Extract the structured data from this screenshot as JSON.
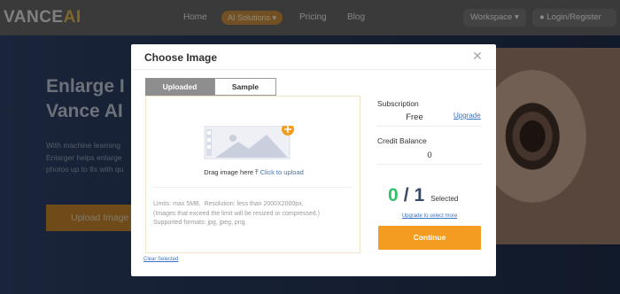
{
  "nav": {
    "logo_main": "VANCE",
    "logo_accent": "AI",
    "home": "Home",
    "ai_solutions": "AI Solutions",
    "pricing": "Pricing",
    "blog": "Blog",
    "workspace": "Workspace",
    "login": "Login/Register"
  },
  "hero": {
    "title": "Enlarge I\nVance AI",
    "description": "With machine learning\nEnlarger helps enlarge\nphotos up to 8x with qu",
    "upload_button": "Upload Image"
  },
  "modal": {
    "title": "Choose Image",
    "close_icon": "close-icon",
    "tabs": [
      {
        "label": "Uploaded",
        "active": true
      },
      {
        "label": "Sample",
        "active": false
      }
    ],
    "drop_zone": {
      "prompt": "Drag image here",
      "upload_icon": "upload-icon",
      "upload_link": "Click to upload",
      "limits": "Limits: max 5MB,  Resolution: less than 2000X2000px,\n(Images that exceed the limit will be resized or compressed.)\nSupported formats: jpg, jpeg, png."
    },
    "clear_selected": "Clear Selected",
    "subscription": {
      "label": "Subscription",
      "value": "Free",
      "upgrade": "Upgrade"
    },
    "credit_balance": {
      "label": "Credit Balance",
      "value": "0"
    },
    "selection": {
      "selected": "0",
      "separator": "/",
      "total": "1",
      "label": "Selected",
      "upgrade_more": "Upgrade to select more"
    },
    "continue_button": "Continue"
  },
  "colors": {
    "accent_orange": "#f39c1f",
    "link_blue": "#3a73c0",
    "selected_green": "#2fc26b",
    "tab_active_gray": "#8e8e8e"
  }
}
